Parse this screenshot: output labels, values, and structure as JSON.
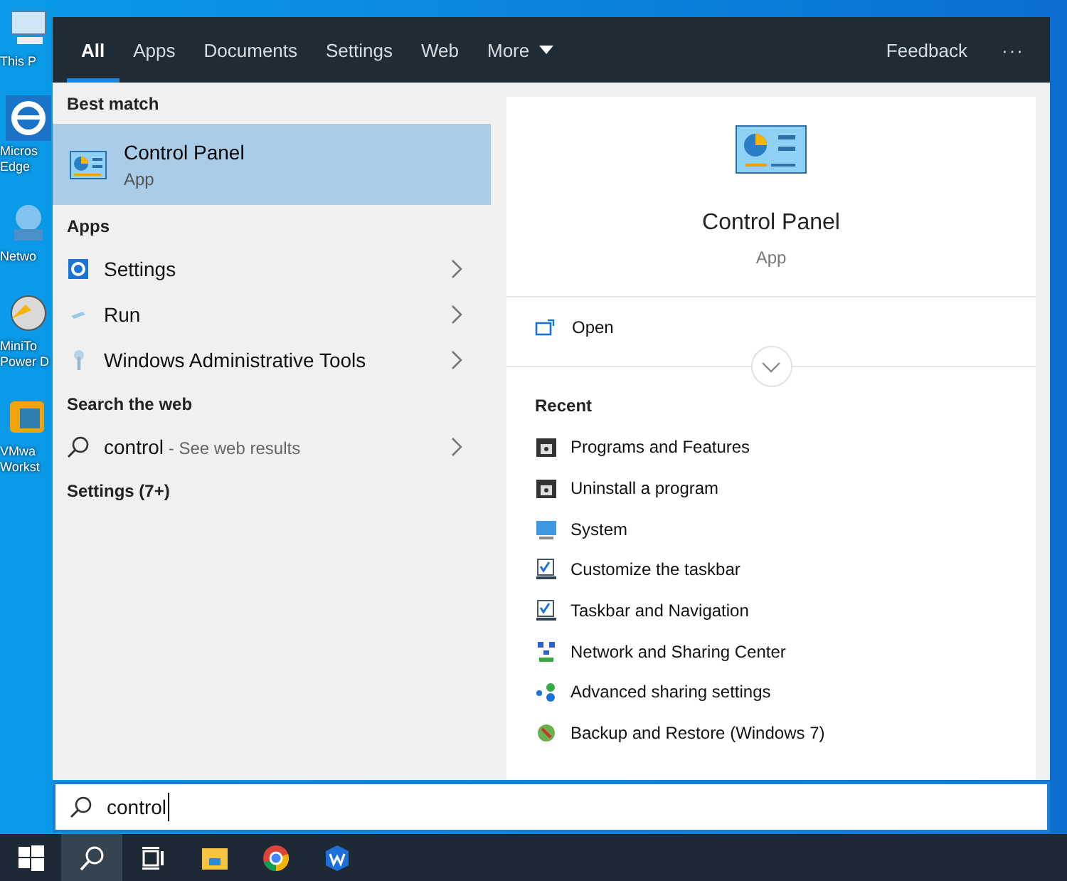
{
  "desktop_icons": [
    {
      "kind": "computer",
      "lines": [
        "This P"
      ]
    },
    {
      "kind": "edge",
      "lines": [
        "Micros",
        "Edge"
      ]
    },
    {
      "kind": "network",
      "lines": [
        "Netwo"
      ]
    },
    {
      "kind": "disk",
      "lines": [
        "MiniTo",
        "Power D"
      ]
    },
    {
      "kind": "vm",
      "lines": [
        "VMwa",
        "Workst"
      ]
    }
  ],
  "tabs": [
    {
      "label": "All",
      "selected": true,
      "dropdown": false
    },
    {
      "label": "Apps",
      "selected": false,
      "dropdown": false
    },
    {
      "label": "Documents",
      "selected": false,
      "dropdown": false
    },
    {
      "label": "Settings",
      "selected": false,
      "dropdown": false
    },
    {
      "label": "Web",
      "selected": false,
      "dropdown": false
    },
    {
      "label": "More",
      "selected": false,
      "dropdown": true
    }
  ],
  "feedback": "Feedback",
  "more_options": "···",
  "results": {
    "best_match": {
      "heading": "Best match",
      "title": "Control Panel",
      "subtitle": "App",
      "selected": true
    },
    "apps": {
      "heading": "Apps",
      "items": [
        {
          "label": "Settings",
          "kind": "gear"
        },
        {
          "label": "Run",
          "kind": "run"
        },
        {
          "label": "Windows Administrative Tools",
          "kind": "tools"
        }
      ]
    },
    "web": {
      "heading": "Search the web",
      "query": "control",
      "hint": " - See web results"
    },
    "settings_group": {
      "heading": "Settings (7+)"
    }
  },
  "preview": {
    "title": "Control Panel",
    "subtitle": "App",
    "open": "Open",
    "recent_heading": "Recent",
    "recent": [
      {
        "label": "Programs and Features",
        "kind": "installer"
      },
      {
        "label": "Uninstall a program",
        "kind": "installer"
      },
      {
        "label": "System",
        "kind": "system"
      },
      {
        "label": "Customize the taskbar",
        "kind": "taskbar"
      },
      {
        "label": "Taskbar and Navigation",
        "kind": "taskbar"
      },
      {
        "label": "Network and Sharing Center",
        "kind": "network"
      },
      {
        "label": "Advanced sharing settings",
        "kind": "sharing"
      },
      {
        "label": "Backup and Restore (Windows 7)",
        "kind": "backup"
      }
    ]
  },
  "search_box": {
    "value": "control"
  },
  "taskbar": [
    {
      "kind": "start",
      "selected": false
    },
    {
      "kind": "search",
      "selected": true
    },
    {
      "kind": "taskview",
      "selected": false
    },
    {
      "kind": "explorer",
      "selected": false
    },
    {
      "kind": "chrome",
      "selected": false
    },
    {
      "kind": "office",
      "selected": false
    }
  ]
}
